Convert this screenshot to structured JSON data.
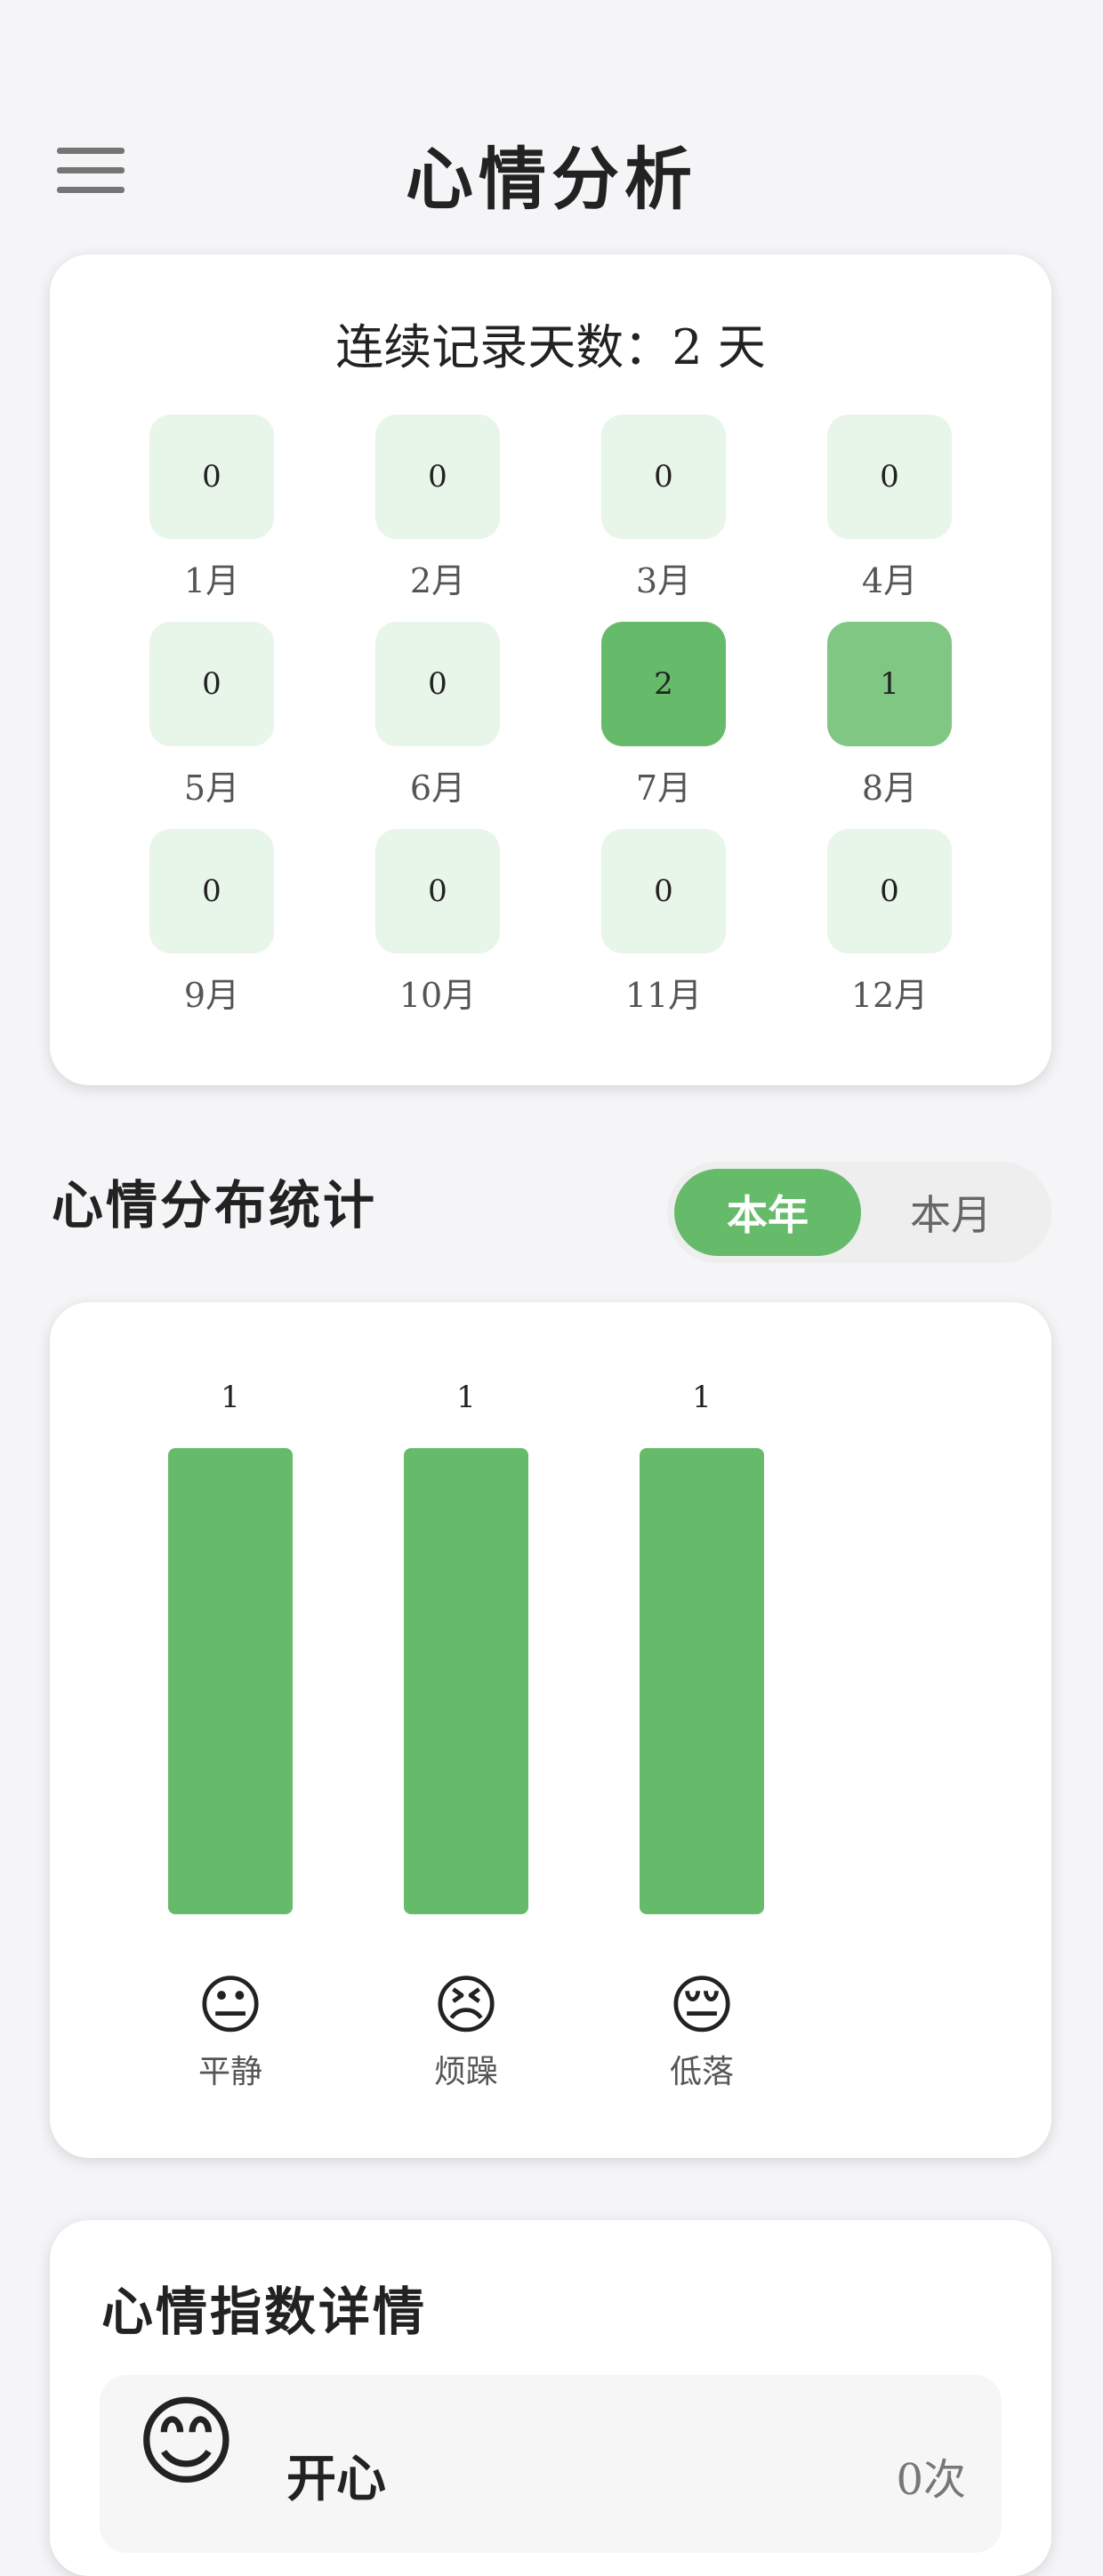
{
  "header": {
    "title": "心情分析",
    "menu_icon": "hamburger-menu-icon"
  },
  "streak": {
    "text": "连续记录天数：2 天",
    "months": [
      {
        "label": "1月",
        "count": "0",
        "color": "#e8f5e9"
      },
      {
        "label": "2月",
        "count": "0",
        "color": "#e8f5e9"
      },
      {
        "label": "3月",
        "count": "0",
        "color": "#e8f5e9"
      },
      {
        "label": "4月",
        "count": "0",
        "color": "#e8f5e9"
      },
      {
        "label": "5月",
        "count": "0",
        "color": "#e8f5e9"
      },
      {
        "label": "6月",
        "count": "0",
        "color": "#e8f5e9"
      },
      {
        "label": "7月",
        "count": "2",
        "color": "#66bb6a"
      },
      {
        "label": "8月",
        "count": "1",
        "color": "#81c784"
      },
      {
        "label": "9月",
        "count": "0",
        "color": "#e8f5e9"
      },
      {
        "label": "10月",
        "count": "0",
        "color": "#e8f5e9"
      },
      {
        "label": "11月",
        "count": "0",
        "color": "#e8f5e9"
      },
      {
        "label": "12月",
        "count": "0",
        "color": "#e8f5e9"
      }
    ]
  },
  "distribution": {
    "title": "心情分布统计",
    "toggle": {
      "year_label": "本年",
      "month_label": "本月",
      "selected": "本年"
    }
  },
  "chart_data": {
    "type": "bar",
    "categories": [
      "平静",
      "烦躁",
      "低落"
    ],
    "emojis": [
      "😐",
      "😣",
      "😔"
    ],
    "values": [
      1,
      1,
      1
    ],
    "data_labels": [
      "1",
      "1",
      "1"
    ],
    "ylim": [
      0,
      1
    ],
    "bar_color": "#66bb6a"
  },
  "details": {
    "title": "心情指数详情",
    "items": [
      {
        "emoji": "😊",
        "name": "开心",
        "count": "0次"
      }
    ]
  },
  "colors": {
    "accent": "#66bb6a",
    "light_green": "#e8f5e9",
    "mid_green": "#81c784"
  }
}
